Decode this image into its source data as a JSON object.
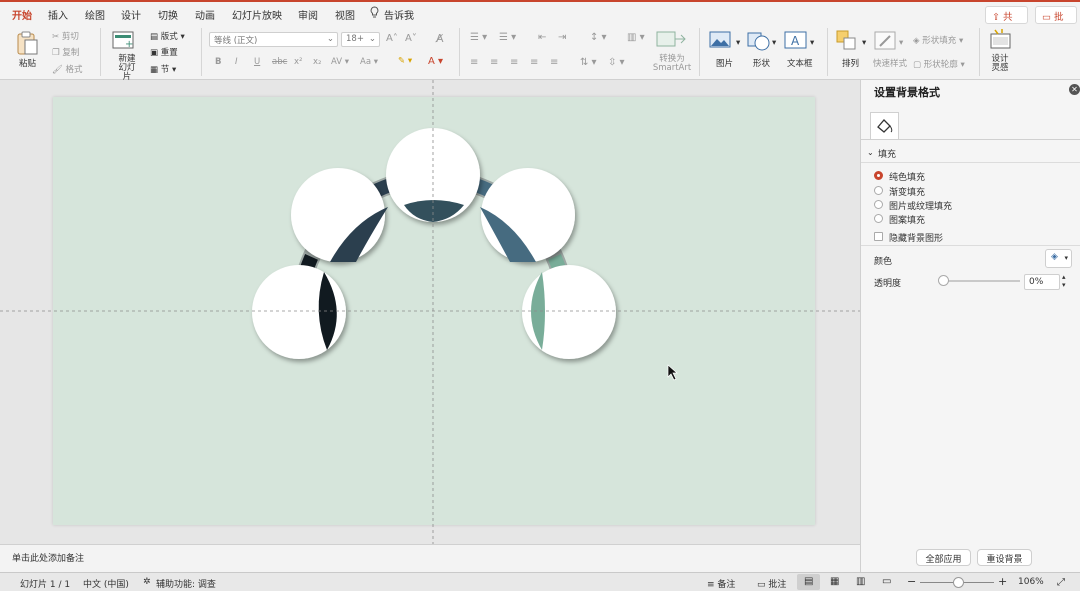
{
  "tabs": [
    "开始",
    "插入",
    "绘图",
    "设计",
    "切换",
    "动画",
    "幻灯片放映",
    "审阅",
    "视图"
  ],
  "tell_me": "告诉我",
  "share_label": "共享",
  "comments_label": "批注",
  "ribbon": {
    "paste": "粘贴",
    "cut": "剪切",
    "copy": "复制",
    "format_painter": "格式",
    "new_slide_line1": "新建",
    "new_slide_line2": "幻灯片",
    "layout": "版式",
    "reset": "重置",
    "section": "节",
    "font_name": "等线 (正文)",
    "font_size": "18+",
    "convert_line1": "转换为",
    "convert_line2": "SmartArt",
    "picture": "图片",
    "shape": "形状",
    "textbox": "文本框",
    "arrange": "排列",
    "quick_styles": "快速样式",
    "shape_fill": "形状填充",
    "shape_outline": "形状轮廓",
    "designer_line1": "设计",
    "designer_line2": "灵感"
  },
  "notes_placeholder": "单击此处添加备注",
  "panel": {
    "title": "设置背景格式",
    "section_fill": "填充",
    "options": [
      "纯色填充",
      "渐变填充",
      "图片或纹理填充",
      "图案填充"
    ],
    "selected_option": "纯色填充",
    "hide_bg": "隐藏背景图形",
    "color_label": "颜色",
    "transparency_label": "透明度",
    "transparency_value": "0%",
    "transparency_fraction": 0,
    "apply_all": "全部应用",
    "reset_bg": "重设背景"
  },
  "status": {
    "slide_info": "幻灯片 1 / 1",
    "language": "中文 (中国)",
    "accessibility": "辅助功能: 调查",
    "notes": "备注",
    "comments": "批注",
    "zoom": "106%",
    "zoom_fraction": 0.45
  },
  "colors": {
    "accent": "#c8452d",
    "slide_bg": "#d6e5db",
    "arc1": "#111a20",
    "arc2": "#2b3f4e",
    "arc3": "#33505c",
    "arc4": "#466b80",
    "arc5": "#79ad99"
  }
}
